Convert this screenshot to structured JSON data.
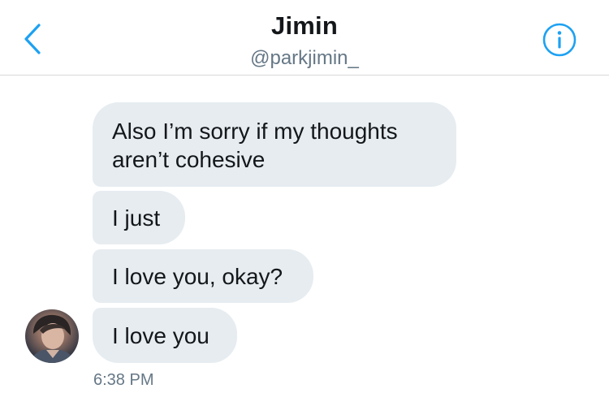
{
  "header": {
    "title": "Jimin",
    "handle": "@parkjimin_",
    "back_icon": "chevron-left-icon",
    "info_icon": "info-icon",
    "accent_color": "#1da1f2"
  },
  "messages": [
    {
      "text": "Also I’m sorry if my thoughts aren’t cohesive"
    },
    {
      "text": "I just"
    },
    {
      "text": "I love you, okay?"
    },
    {
      "text": "I love you"
    }
  ],
  "timestamp": "6:38 PM",
  "colors": {
    "bubble_background": "#e6ecf0",
    "secondary_text": "#657786"
  }
}
